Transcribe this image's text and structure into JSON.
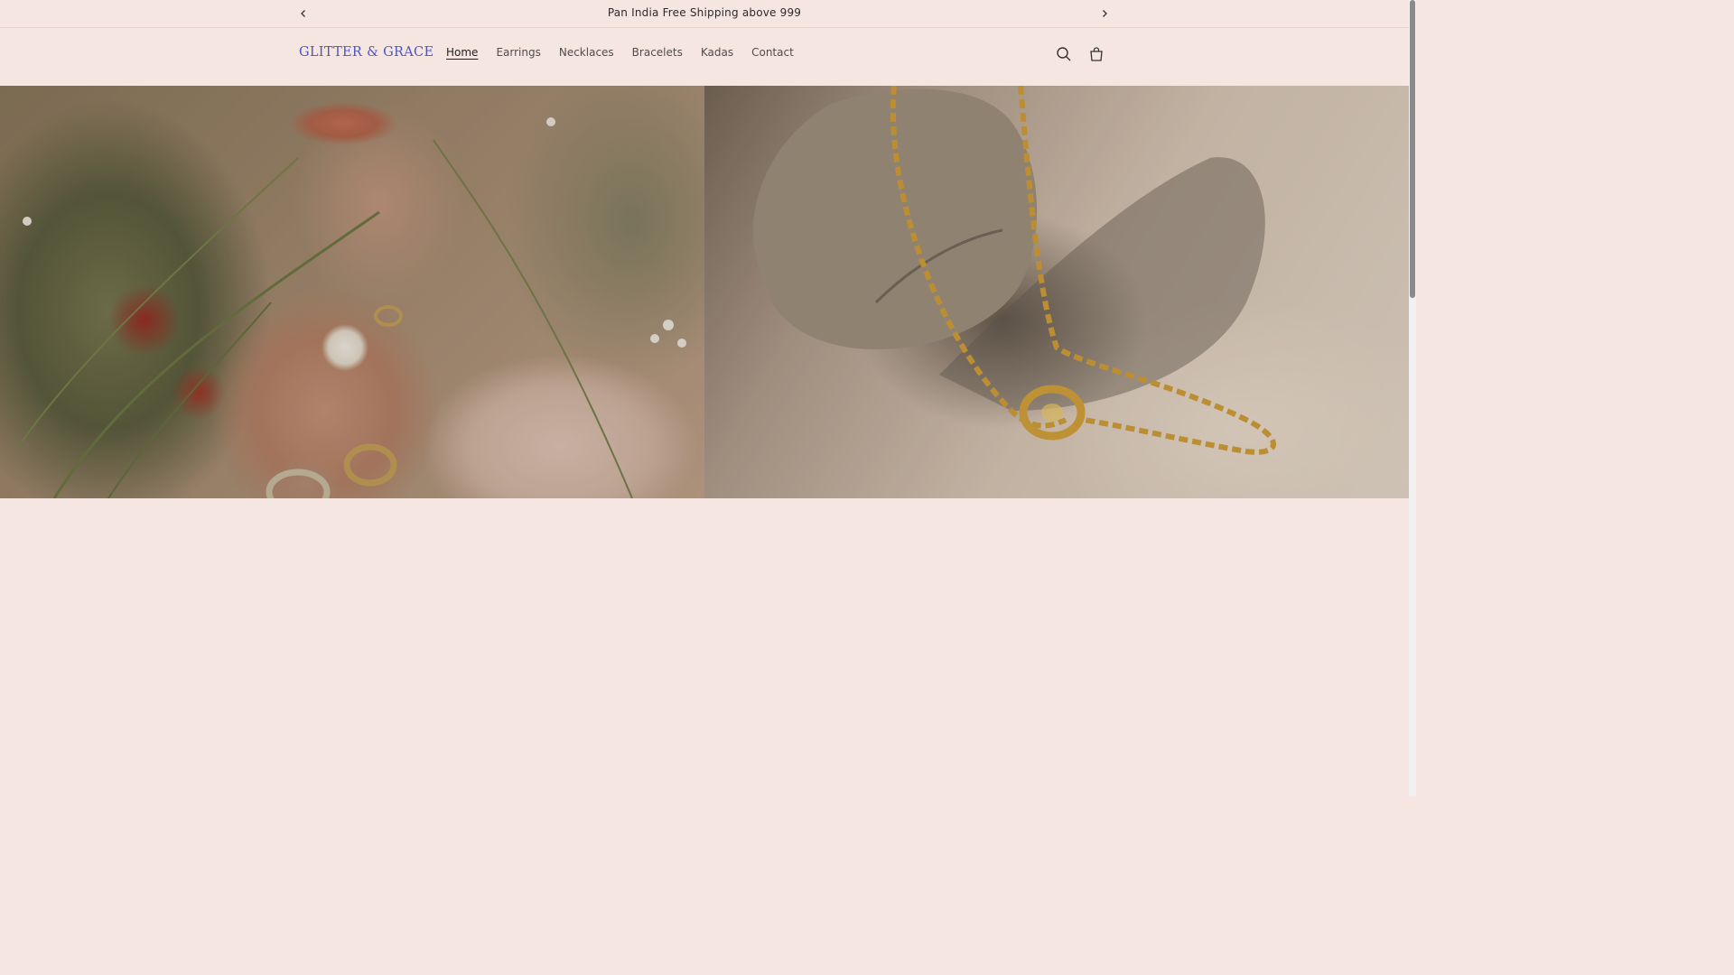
{
  "announcement": {
    "text": "Pan India Free Shipping above 999",
    "prev_icon": "chevron-left-icon",
    "next_icon": "chevron-right-icon"
  },
  "header": {
    "logo": "GLITTER & GRACE",
    "nav": [
      {
        "label": "Home",
        "active": true
      },
      {
        "label": "Earrings"
      },
      {
        "label": "Necklaces"
      },
      {
        "label": "Bracelets"
      },
      {
        "label": "Kadas"
      },
      {
        "label": "Contact"
      }
    ],
    "icons": [
      "search-icon",
      "cart-icon"
    ]
  },
  "hero": {
    "images": [
      "model-with-rings-and-flowers-image",
      "gold-chain-necklace-on-stone-image"
    ]
  },
  "colors": {
    "background": "#f6e6e1",
    "logo": "#4a56c4",
    "text": "#2b2b2b"
  }
}
